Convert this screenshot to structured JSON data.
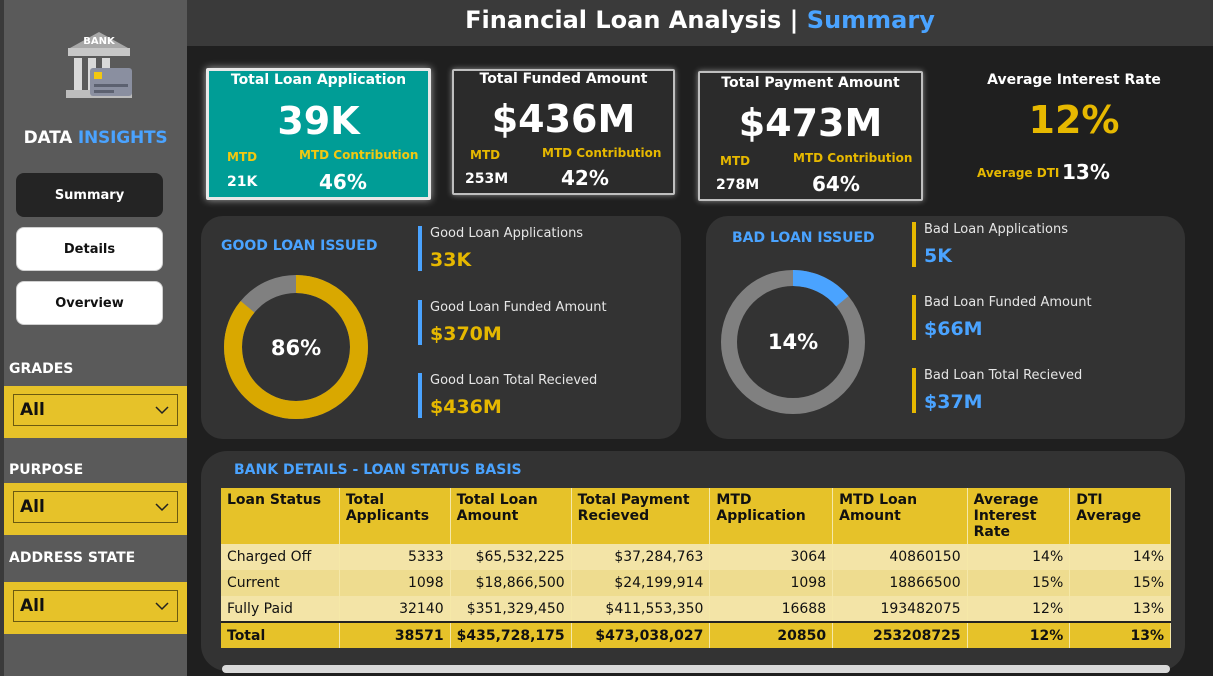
{
  "header": {
    "title_white": "Financial Loan Analysis | ",
    "title_blue": "Summary"
  },
  "sidebar": {
    "logo_text": "BANK",
    "brand_white": "DATA ",
    "brand_blue": "INSIGHTS",
    "nav": [
      {
        "label": "Summary"
      },
      {
        "label": "Details"
      },
      {
        "label": "Overview"
      }
    ],
    "filters": [
      {
        "title": "GRADES",
        "value": "All"
      },
      {
        "title": "PURPOSE",
        "value": "All"
      },
      {
        "title": "ADDRESS STATE",
        "value": "All"
      }
    ]
  },
  "kpis": {
    "applications": {
      "label": "Total Loan Application",
      "value": "39K",
      "mtd_label": "MTD",
      "mtd_value": "21K",
      "contrib_label": "MTD Contribution",
      "contrib_value": "46%"
    },
    "funded": {
      "label": "Total Funded Amount",
      "value": "$436M",
      "mtd_label": "MTD",
      "mtd_value": "253M",
      "contrib_label": "MTD Contribution",
      "contrib_value": "42%"
    },
    "payment": {
      "label": "Total Payment Amount",
      "value": "$473M",
      "mtd_label": "MTD",
      "mtd_value": "278M",
      "contrib_label": "MTD Contribution",
      "contrib_value": "64%"
    },
    "interest": {
      "label": "Average Interest Rate",
      "value": "12%",
      "dti_label": "Average DTI",
      "dti_value": "13%"
    }
  },
  "good_loan": {
    "title": "GOOD LOAN ISSUED",
    "percent_label": "86%",
    "percent": 86,
    "apps_label": "Good Loan Applications",
    "apps_value": "33K",
    "funded_label": "Good Loan Funded Amount",
    "funded_value": "$370M",
    "received_label": "Good Loan Total Recieved",
    "received_value": "$436M"
  },
  "bad_loan": {
    "title": "BAD LOAN ISSUED",
    "percent_label": "14%",
    "percent": 14,
    "apps_label": "Bad Loan Applications",
    "apps_value": "5K",
    "funded_label": "Bad Loan Funded Amount",
    "funded_value": "$66M",
    "received_label": "Bad Loan Total Recieved",
    "received_value": "$37M"
  },
  "bank_details": {
    "title": "BANK DETAILS -  LOAN STATUS BASIS",
    "columns": [
      "Loan Status",
      "Total Applicants",
      "Total Loan Amount",
      "Total Payment Recieved",
      "MTD Application",
      "MTD Loan Amount",
      "Average Interest Rate",
      "DTI Average"
    ],
    "rows": [
      [
        "Charged Off",
        "5333",
        "$65,532,225",
        "$37,284,763",
        "3064",
        "40860150",
        "14%",
        "14%"
      ],
      [
        "Current",
        "1098",
        "$18,866,500",
        "$24,199,914",
        "1098",
        "18866500",
        "15%",
        "15%"
      ],
      [
        "Fully Paid",
        "32140",
        "$351,329,450",
        "$411,553,350",
        "16688",
        "193482075",
        "12%",
        "13%"
      ]
    ],
    "total": [
      "Total",
      "38571",
      "$435,728,175",
      "$473,038,027",
      "20850",
      "253208725",
      "12%",
      "13%"
    ]
  },
  "colors": {
    "accent_blue": "#4aa3ff",
    "gold": "#e6b800",
    "teal": "#009d96",
    "good_ring": "#d9a800",
    "bad_ring": "#4aa3ff",
    "ring_rest": "#808080"
  }
}
